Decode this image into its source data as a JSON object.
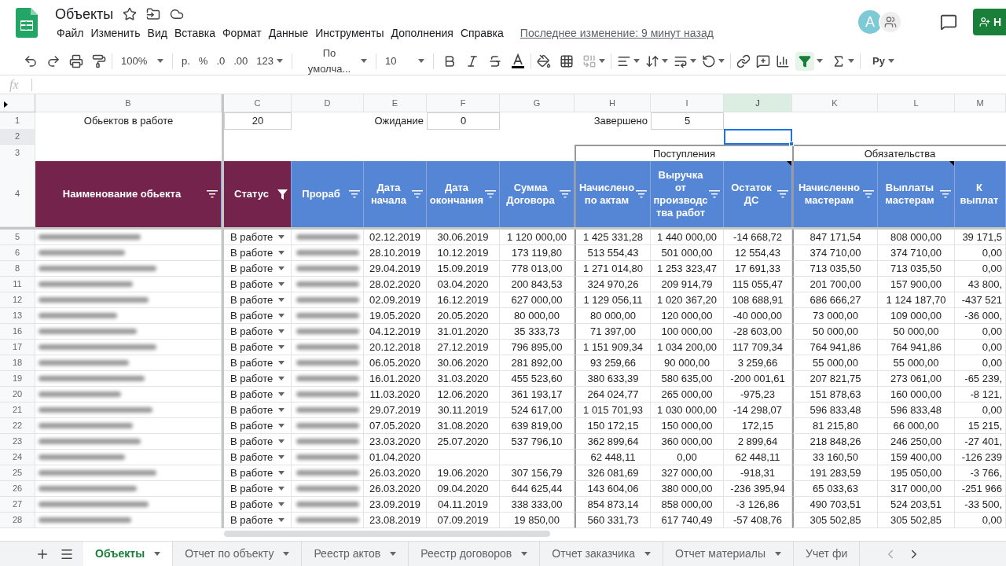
{
  "document": {
    "title": "Объекты",
    "last_edit": "Последнее изменение: 9 минут назад"
  },
  "menu": [
    "Файл",
    "Изменить",
    "Вид",
    "Вставка",
    "Формат",
    "Данные",
    "Инструменты",
    "Дополнения",
    "Справка"
  ],
  "account": {
    "initial": "A"
  },
  "share_button": {
    "label": "Н"
  },
  "toolbar": {
    "zoom": "100%",
    "currency": "р.",
    "percent": "%",
    "decrease_decimals": ".0",
    "increase_decimals": ".00",
    "more_formats": "123",
    "font": "По умолча...",
    "font_size": "10",
    "filter_on": true,
    "addon": "Pу"
  },
  "formula_bar": {
    "label": "fx"
  },
  "columns": [
    {
      "letter": "B",
      "selected": false
    },
    {
      "letter": "C",
      "selected": false
    },
    {
      "letter": "D",
      "selected": false
    },
    {
      "letter": "E",
      "selected": false
    },
    {
      "letter": "F",
      "selected": false
    },
    {
      "letter": "G",
      "selected": false
    },
    {
      "letter": "H",
      "selected": false
    },
    {
      "letter": "I",
      "selected": false
    },
    {
      "letter": "J",
      "selected": true
    },
    {
      "letter": "K",
      "selected": false
    },
    {
      "letter": "L",
      "selected": false
    },
    {
      "letter": "M",
      "selected": false
    }
  ],
  "top_rows": [
    {
      "number": "1",
      "selected": false
    },
    {
      "number": "2",
      "selected": true
    },
    {
      "number": "3",
      "selected": false
    },
    {
      "number": "4",
      "selected": false
    }
  ],
  "summary": [
    {
      "label": "Обьектов в работе",
      "value": "20"
    },
    {
      "label": "Ожидание",
      "value": "0"
    },
    {
      "label": "Завершено",
      "value": "5"
    }
  ],
  "groups": [
    {
      "label": "Поступления"
    },
    {
      "label": "Обязательства"
    }
  ],
  "headers": [
    {
      "label": "Наименование обьекта",
      "color": "#74244c",
      "filtered": false,
      "note": false
    },
    {
      "label": "Статус",
      "color": "#74244c",
      "filtered": true,
      "note": false
    },
    {
      "label": "Прораб",
      "color": "#5585d5",
      "filtered": false,
      "note": false
    },
    {
      "label": "Дата начала",
      "color": "#5585d5",
      "filtered": false,
      "note": false
    },
    {
      "label": "Дата окончания",
      "color": "#5585d5",
      "filtered": false,
      "note": false
    },
    {
      "label": "Сумма Договора",
      "color": "#5585d5",
      "filtered": false,
      "note": false
    },
    {
      "label": "Начислено по актам",
      "color": "#5585d5",
      "filtered": false,
      "note": false
    },
    {
      "label": "Выручка от производства работ",
      "color": "#5585d5",
      "filtered": false,
      "note": false
    },
    {
      "label": "Остаток ДС",
      "color": "#5585d5",
      "filtered": false,
      "note": true
    },
    {
      "label": "Начисленно мастерам",
      "color": "#5585d5",
      "filtered": false,
      "note": false
    },
    {
      "label": "Выплаты мастерам",
      "color": "#5585d5",
      "filtered": false,
      "note": true
    },
    {
      "label": "К выплат",
      "color": "#5585d5",
      "note": false
    }
  ],
  "rows": [
    {
      "number": "5",
      "selected": false,
      "status": "В работе",
      "start": "02.12.2019",
      "end": "30.06.2019",
      "contract_sum": "1 120 000,00",
      "accrued": "1 425 331,28",
      "revenue": "1 440 000,00",
      "balance": "-14 668,72",
      "accrued_masters": "847 171,54",
      "paid_masters": "808 000,00",
      "to_pay": "39 171,5"
    },
    {
      "number": "6",
      "selected": false,
      "status": "В работе",
      "start": "28.10.2019",
      "end": "10.12.2019",
      "contract_sum": "173 119,80",
      "accrued": "513 554,43",
      "revenue": "501 000,00",
      "balance": "12 554,43",
      "accrued_masters": "374 710,00",
      "paid_masters": "374 710,00",
      "to_pay": "0,00"
    },
    {
      "number": "8",
      "selected": false,
      "status": "В работе",
      "start": "29.04.2019",
      "end": "15.09.2019",
      "contract_sum": "778 013,00",
      "accrued": "1 271 014,80",
      "revenue": "1 253 323,47",
      "balance": "17 691,33",
      "accrued_masters": "713 035,50",
      "paid_masters": "713 035,50",
      "to_pay": "0,00"
    },
    {
      "number": "11",
      "selected": false,
      "status": "В работе",
      "start": "28.02.2020",
      "end": "03.04.2020",
      "contract_sum": "200 843,53",
      "accrued": "324 970,26",
      "revenue": "209 914,79",
      "balance": "115 055,47",
      "accrued_masters": "201 700,00",
      "paid_masters": "157 900,00",
      "to_pay": "43 800,"
    },
    {
      "number": "12",
      "selected": false,
      "status": "В работе",
      "start": "02.09.2019",
      "end": "16.12.2019",
      "contract_sum": "627 000,00",
      "accrued": "1 129 056,11",
      "revenue": "1 020 367,20",
      "balance": "108 688,91",
      "accrued_masters": "686 666,27",
      "paid_masters": "1 124 187,70",
      "to_pay": "-437 521"
    },
    {
      "number": "13",
      "selected": false,
      "status": "В работе",
      "start": "19.05.2020",
      "end": "20.05.2020",
      "contract_sum": "80 000,00",
      "accrued": "80 000,00",
      "revenue": "120 000,00",
      "balance": "-40 000,00",
      "accrued_masters": "73 000,00",
      "paid_masters": "109 000,00",
      "to_pay": "-36 000,"
    },
    {
      "number": "16",
      "selected": false,
      "status": "В работе",
      "start": "04.12.2019",
      "end": "31.01.2020",
      "contract_sum": "35 333,73",
      "accrued": "71 397,00",
      "revenue": "100 000,00",
      "balance": "-28 603,00",
      "accrued_masters": "50 000,00",
      "paid_masters": "50 000,00",
      "to_pay": "0,00"
    },
    {
      "number": "17",
      "selected": false,
      "status": "В работе",
      "start": "20.12.2018",
      "end": "27.12.2019",
      "contract_sum": "796 895,00",
      "accrued": "1 151 909,34",
      "revenue": "1 034 200,00",
      "balance": "117 709,34",
      "accrued_masters": "764 941,86",
      "paid_masters": "764 941,86",
      "to_pay": "0,00"
    },
    {
      "number": "18",
      "selected": false,
      "status": "В работе",
      "start": "06.05.2020",
      "end": "30.06.2020",
      "contract_sum": "281 892,00",
      "accrued": "93 259,66",
      "revenue": "90 000,00",
      "balance": "3 259,66",
      "accrued_masters": "55 000,00",
      "paid_masters": "55 000,00",
      "to_pay": "0,00"
    },
    {
      "number": "19",
      "selected": false,
      "status": "В работе",
      "start": "16.01.2020",
      "end": "31.03.2020",
      "contract_sum": "455 523,60",
      "accrued": "380 633,39",
      "revenue": "580 635,00",
      "balance": "-200 001,61",
      "accrued_masters": "207 821,75",
      "paid_masters": "273 061,00",
      "to_pay": "-65 239,"
    },
    {
      "number": "20",
      "selected": false,
      "status": "В работе",
      "start": "11.03.2020",
      "end": "12.06.2020",
      "contract_sum": "361 193,17",
      "accrued": "264 024,77",
      "revenue": "265 000,00",
      "balance": "-975,23",
      "accrued_masters": "151 878,63",
      "paid_masters": "160 000,00",
      "to_pay": "-8 121,"
    },
    {
      "number": "21",
      "selected": false,
      "status": "В работе",
      "start": "29.07.2019",
      "end": "30.11.2019",
      "contract_sum": "524 617,00",
      "accrued": "1 015 701,93",
      "revenue": "1 030 000,00",
      "balance": "-14 298,07",
      "accrued_masters": "596 833,48",
      "paid_masters": "596 833,48",
      "to_pay": "0,00"
    },
    {
      "number": "22",
      "selected": false,
      "status": "В работе",
      "start": "07.05.2020",
      "end": "31.08.2020",
      "contract_sum": "639 819,00",
      "accrued": "150 172,15",
      "revenue": "150 000,00",
      "balance": "172,15",
      "accrued_masters": "81 215,80",
      "paid_masters": "66 000,00",
      "to_pay": "15 215,"
    },
    {
      "number": "23",
      "selected": false,
      "status": "В работе",
      "start": "23.03.2020",
      "end": "25.07.2020",
      "contract_sum": "537 796,10",
      "accrued": "362 899,64",
      "revenue": "360 000,00",
      "balance": "2 899,64",
      "accrued_masters": "218 848,26",
      "paid_masters": "246 250,00",
      "to_pay": "-27 401,"
    },
    {
      "number": "24",
      "selected": false,
      "status": "В работе",
      "start": "01.04.2020",
      "accrued": "62 448,11",
      "revenue": "0,00",
      "balance": "62 448,11",
      "accrued_masters": "33 160,50",
      "paid_masters": "159 400,00",
      "to_pay": "-126 239"
    },
    {
      "number": "25",
      "selected": false,
      "status": "В работе",
      "start": "26.03.2020",
      "end": "19.06.2020",
      "contract_sum": "307 156,79",
      "accrued": "326 081,69",
      "revenue": "327 000,00",
      "balance": "-918,31",
      "accrued_masters": "191 283,59",
      "paid_masters": "195 050,00",
      "to_pay": "-3 766,"
    },
    {
      "number": "26",
      "selected": false,
      "status": "В работе",
      "start": "26.03.2020",
      "end": "09.04.2020",
      "contract_sum": "644 625,44",
      "accrued": "143 604,06",
      "revenue": "380 000,00",
      "balance": "-236 395,94",
      "accrued_masters": "65 033,63",
      "paid_masters": "317 000,00",
      "to_pay": "-251 966"
    },
    {
      "number": "27",
      "selected": false,
      "status": "В работе",
      "start": "23.09.2019",
      "end": "04.11.2019",
      "contract_sum": "338 333,00",
      "accrued": "854 873,14",
      "revenue": "858 000,00",
      "balance": "-3 126,86",
      "accrued_masters": "490 703,51",
      "paid_masters": "524 203,51",
      "to_pay": "-33 500,"
    },
    {
      "number": "28",
      "selected": false,
      "status": "В работе",
      "start": "23.08.2019",
      "end": "07.09.2019",
      "contract_sum": "19 850,00",
      "accrued": "560 331,73",
      "revenue": "617 740,49",
      "balance": "-57 408,76",
      "accrued_masters": "305 502,85",
      "paid_masters": "305 502,85",
      "to_pay": "0,00"
    }
  ],
  "sheet_tabs": [
    {
      "label": "Объекты",
      "selected": true
    },
    {
      "label": "Отчет по объекту",
      "selected": false
    },
    {
      "label": "Реестр актов",
      "selected": false
    },
    {
      "label": "Реестр договоров",
      "selected": false
    },
    {
      "label": "Отчет заказчика",
      "selected": false
    },
    {
      "label": "Отчет материалы",
      "selected": false
    },
    {
      "label": "Учет фи",
      "selected": false
    }
  ]
}
